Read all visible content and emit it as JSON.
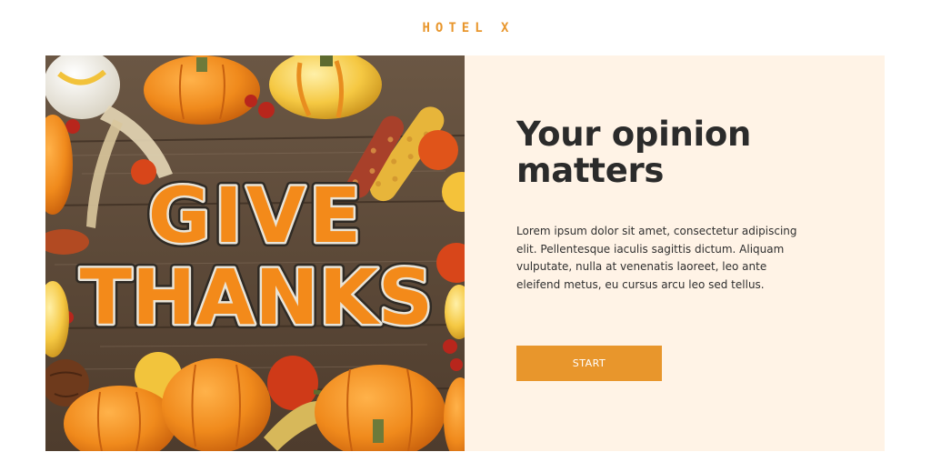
{
  "header": {
    "brand": "HOTEL X"
  },
  "hero": {
    "image": "thanksgiving-pumpkins-give-thanks-cookies",
    "lettering": [
      "GIVE",
      "THANKS"
    ]
  },
  "content": {
    "headline": "Your opinion matters",
    "body": "Lorem ipsum dolor sit amet, consectetur adipiscing elit. Pellentesque iaculis sagittis dictum. Aliquam vulputate, nulla at venenatis laoreet, leo ante eleifend metus, eu cursus arcu leo sed tellus.",
    "start_label": "START"
  },
  "colors": {
    "accent": "#e8962c",
    "panel_bg": "#fff3e6",
    "text": "#2b2b2b"
  }
}
